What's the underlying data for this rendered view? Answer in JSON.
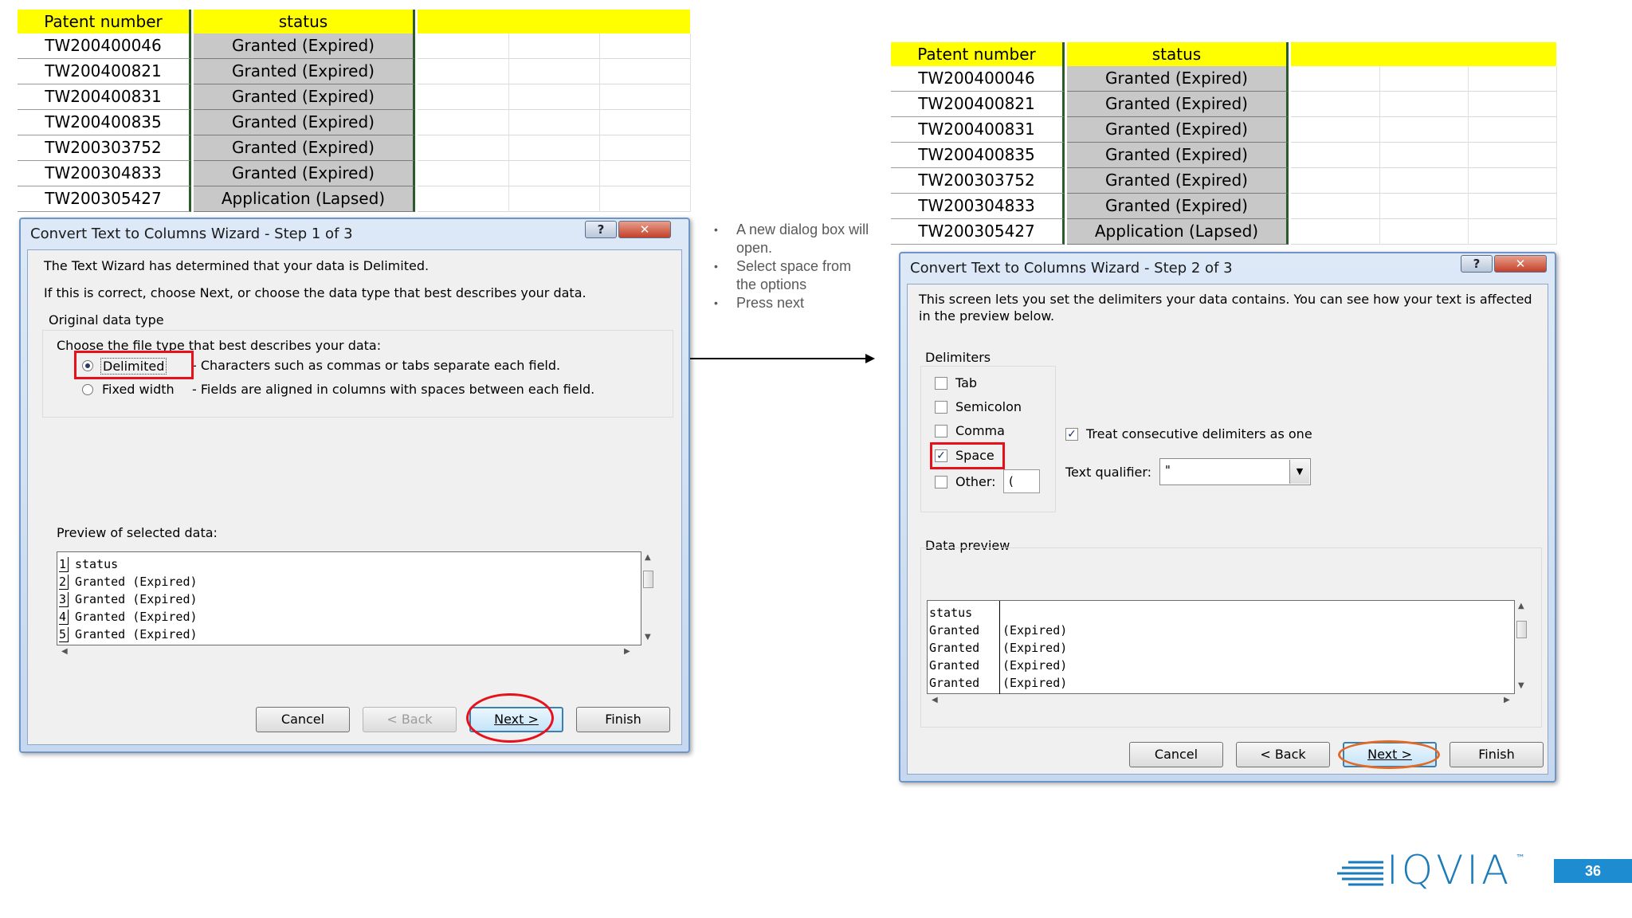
{
  "sheet": {
    "header_patent": "Patent number",
    "header_status": "status",
    "rows": [
      {
        "patent": "TW200400046",
        "status": "Granted (Expired)"
      },
      {
        "patent": "TW200400821",
        "status": "Granted (Expired)"
      },
      {
        "patent": "TW200400831",
        "status": "Granted (Expired)"
      },
      {
        "patent": "TW200400835",
        "status": "Granted (Expired)"
      },
      {
        "patent": "TW200303752",
        "status": "Granted (Expired)"
      },
      {
        "patent": "TW200304833",
        "status": "Granted (Expired)"
      },
      {
        "patent": "TW200305427",
        "status": "Application (Lapsed)"
      }
    ]
  },
  "step1": {
    "title": "Convert Text to Columns Wizard - Step 1 of 3",
    "help_label": "?",
    "close_label": "✕",
    "line1": "The Text Wizard has determined that your data is Delimited.",
    "line2": "If this is correct, choose Next, or choose the data type that best describes your data.",
    "group_label": "Original data type",
    "choose_label": "Choose the file type that best describes your data:",
    "delimited_label": "Delimited",
    "delimited_desc": "- Characters such as commas or tabs separate each field.",
    "fixed_label": "Fixed width",
    "fixed_desc": "- Fields are aligned in columns with spaces between each field.",
    "selected_type": "Delimited",
    "preview_label": "Preview of selected data:",
    "preview_rows": [
      {
        "n": "1",
        "text": "status"
      },
      {
        "n": "2",
        "text": "Granted (Expired)"
      },
      {
        "n": "3",
        "text": "Granted (Expired)"
      },
      {
        "n": "4",
        "text": "Granted (Expired)"
      },
      {
        "n": "5",
        "text": "Granted (Expired)"
      }
    ],
    "cancel": "Cancel",
    "back": "< Back",
    "next": "Next >",
    "finish": "Finish"
  },
  "notes": {
    "items": [
      "A new dialog box will open.",
      "Select space from the options",
      "Press next"
    ]
  },
  "step2": {
    "title": "Convert Text to Columns Wizard - Step 2 of 3",
    "help_label": "?",
    "close_label": "✕",
    "intro": "This screen lets you set the delimiters your data contains.  You can see how your text is affected in the preview below.",
    "delimiters_label": "Delimiters",
    "tab": "Tab",
    "semicolon": "Semicolon",
    "comma": "Comma",
    "space": "Space",
    "other": "Other:",
    "other_value": "(",
    "checked_delimiters": [
      "Space"
    ],
    "consecutive_label": "Treat consecutive delimiters as one",
    "consecutive_checked": true,
    "qualifier_label": "Text qualifier:",
    "qualifier_value": "\"",
    "check_mark": "✓",
    "dropdown_arrow": "▼",
    "preview_label": "Data preview",
    "preview_rows": [
      {
        "c1": "status",
        "c2": ""
      },
      {
        "c1": "Granted",
        "c2": "(Expired)"
      },
      {
        "c1": "Granted",
        "c2": "(Expired)"
      },
      {
        "c1": "Granted",
        "c2": "(Expired)"
      },
      {
        "c1": "Granted",
        "c2": "(Expired)"
      }
    ],
    "cancel": "Cancel",
    "back": "< Back",
    "next": "Next >",
    "finish": "Finish"
  },
  "footer": {
    "logo": "IQVIA",
    "trademark": "™",
    "page_number": "36"
  },
  "colors": {
    "header_yellow": "#ffff00",
    "highlight_red": "#e8101b",
    "highlight_orange": "#e06a28",
    "brand_blue": "#1b7bb8"
  }
}
